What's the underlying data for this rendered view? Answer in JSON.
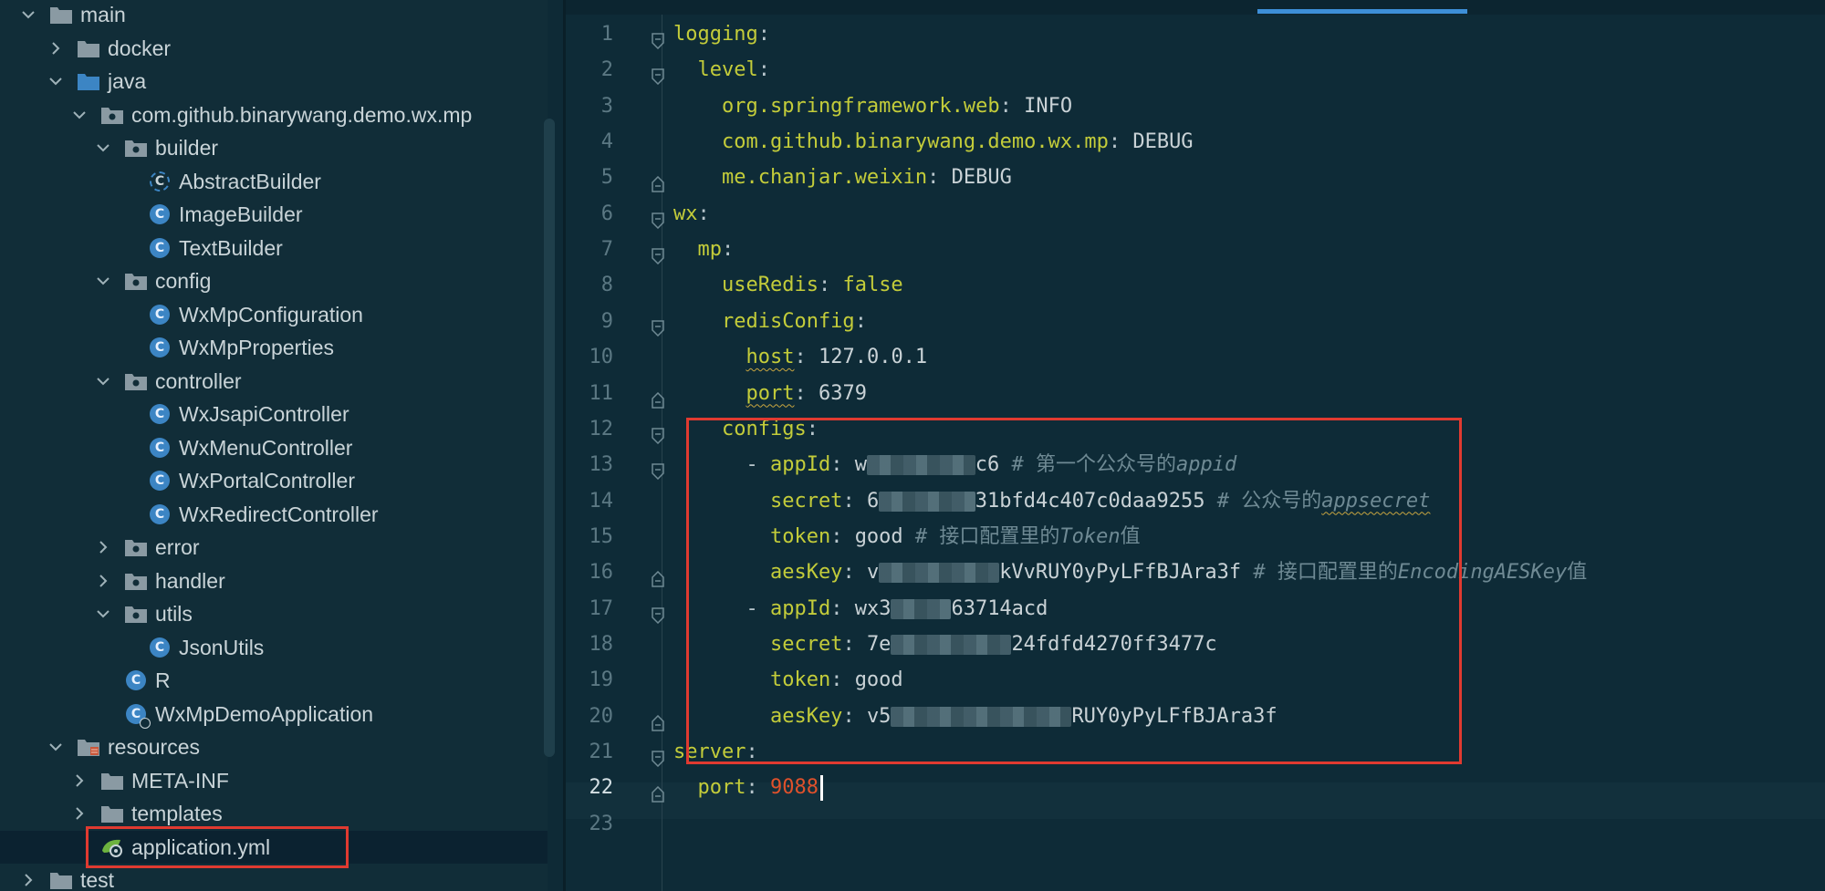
{
  "tree": {
    "items": [
      {
        "label": "main",
        "type": "folder",
        "expanded": true,
        "indent": 0,
        "icon": "folder-icon"
      },
      {
        "label": "docker",
        "type": "folder",
        "expanded": false,
        "indent": 1,
        "icon": "folder-icon"
      },
      {
        "label": "java",
        "type": "folder",
        "expanded": true,
        "indent": 1,
        "icon": "source-folder-icon"
      },
      {
        "label": "com.github.binarywang.demo.wx.mp",
        "type": "package",
        "expanded": true,
        "indent": 2,
        "icon": "package-icon"
      },
      {
        "label": "builder",
        "type": "package",
        "expanded": true,
        "indent": 3,
        "icon": "package-icon"
      },
      {
        "label": "AbstractBuilder",
        "type": "abstract-class",
        "indent": 4,
        "icon": "abstract-class-icon"
      },
      {
        "label": "ImageBuilder",
        "type": "class",
        "indent": 4,
        "icon": "class-icon"
      },
      {
        "label": "TextBuilder",
        "type": "class",
        "indent": 4,
        "icon": "class-icon"
      },
      {
        "label": "config",
        "type": "package",
        "expanded": true,
        "indent": 3,
        "icon": "package-icon"
      },
      {
        "label": "WxMpConfiguration",
        "type": "class",
        "indent": 4,
        "icon": "class-icon"
      },
      {
        "label": "WxMpProperties",
        "type": "class",
        "indent": 4,
        "icon": "class-icon"
      },
      {
        "label": "controller",
        "type": "package",
        "expanded": true,
        "indent": 3,
        "icon": "package-icon"
      },
      {
        "label": "WxJsapiController",
        "type": "class",
        "indent": 4,
        "icon": "class-icon"
      },
      {
        "label": "WxMenuController",
        "type": "class",
        "indent": 4,
        "icon": "class-icon"
      },
      {
        "label": "WxPortalController",
        "type": "class",
        "indent": 4,
        "icon": "class-icon"
      },
      {
        "label": "WxRedirectController",
        "type": "class",
        "indent": 4,
        "icon": "class-icon"
      },
      {
        "label": "error",
        "type": "package",
        "expanded": false,
        "indent": 3,
        "icon": "package-icon"
      },
      {
        "label": "handler",
        "type": "package",
        "expanded": false,
        "indent": 3,
        "icon": "package-icon"
      },
      {
        "label": "utils",
        "type": "package",
        "expanded": true,
        "indent": 3,
        "icon": "package-icon"
      },
      {
        "label": "JsonUtils",
        "type": "class",
        "indent": 4,
        "icon": "class-icon"
      },
      {
        "label": "R",
        "type": "class",
        "indent": 3,
        "icon": "class-icon"
      },
      {
        "label": "WxMpDemoApplication",
        "type": "spring-boot-class",
        "indent": 3,
        "icon": "spring-boot-class-icon"
      },
      {
        "label": "resources",
        "type": "folder",
        "expanded": true,
        "indent": 1,
        "icon": "resources-folder-icon"
      },
      {
        "label": "META-INF",
        "type": "folder",
        "expanded": false,
        "indent": 2,
        "icon": "folder-icon"
      },
      {
        "label": "templates",
        "type": "folder",
        "expanded": false,
        "indent": 2,
        "icon": "folder-icon"
      },
      {
        "label": "application.yml",
        "type": "yml",
        "indent": 2,
        "icon": "spring-yml-icon",
        "selected": true
      },
      {
        "label": "test",
        "type": "folder",
        "expanded": false,
        "indent": 0,
        "icon": "folder-icon"
      }
    ]
  },
  "editor": {
    "current_line": 22,
    "lines": [
      {
        "n": "1",
        "tokens": [
          {
            "t": "logging",
            "c": "k"
          },
          {
            "t": ":",
            "c": "p"
          }
        ]
      },
      {
        "n": "2",
        "tokens": [
          {
            "t": "  level",
            "c": "k"
          },
          {
            "t": ":",
            "c": "p"
          }
        ]
      },
      {
        "n": "3",
        "tokens": [
          {
            "t": "    org.springframework.web",
            "c": "k"
          },
          {
            "t": ": ",
            "c": "p"
          },
          {
            "t": "INFO",
            "c": "v"
          }
        ]
      },
      {
        "n": "4",
        "tokens": [
          {
            "t": "    com.github.binarywang.demo.wx.mp",
            "c": "k"
          },
          {
            "t": ": ",
            "c": "p"
          },
          {
            "t": "DEBUG",
            "c": "v"
          }
        ]
      },
      {
        "n": "5",
        "tokens": [
          {
            "t": "    me.chanjar.weixin",
            "c": "k"
          },
          {
            "t": ": ",
            "c": "p"
          },
          {
            "t": "DEBUG",
            "c": "v"
          }
        ]
      },
      {
        "n": "6",
        "tokens": [
          {
            "t": "wx",
            "c": "k"
          },
          {
            "t": ":",
            "c": "p"
          }
        ]
      },
      {
        "n": "7",
        "tokens": [
          {
            "t": "  mp",
            "c": "k"
          },
          {
            "t": ":",
            "c": "p"
          }
        ]
      },
      {
        "n": "8",
        "tokens": [
          {
            "t": "    useRedis",
            "c": "k"
          },
          {
            "t": ": ",
            "c": "p"
          },
          {
            "t": "false",
            "c": "k"
          }
        ]
      },
      {
        "n": "9",
        "tokens": [
          {
            "t": "    redisConfig",
            "c": "k"
          },
          {
            "t": ":",
            "c": "p"
          }
        ]
      },
      {
        "n": "10",
        "tokens": [
          {
            "t": "      ",
            "c": "p"
          },
          {
            "t": "host",
            "c": "k squig"
          },
          {
            "t": ": ",
            "c": "p"
          },
          {
            "t": "127.0.0.1",
            "c": "v"
          }
        ]
      },
      {
        "n": "11",
        "tokens": [
          {
            "t": "      ",
            "c": "p"
          },
          {
            "t": "port",
            "c": "k squig"
          },
          {
            "t": ": ",
            "c": "p"
          },
          {
            "t": "6379",
            "c": "v"
          }
        ]
      },
      {
        "n": "12",
        "tokens": [
          {
            "t": "    configs",
            "c": "k"
          },
          {
            "t": ":",
            "c": "p"
          }
        ]
      },
      {
        "n": "13",
        "tokens": [
          {
            "t": "      - ",
            "c": "p"
          },
          {
            "t": "appId",
            "c": "k"
          },
          {
            "t": ": ",
            "c": "p"
          },
          {
            "t": "w",
            "c": "v"
          },
          {
            "blur": 9
          },
          {
            "t": "c6",
            "c": "v"
          },
          {
            "t": " # 第一个公众号的",
            "c": "cz"
          },
          {
            "t": "appid",
            "c": "c"
          }
        ]
      },
      {
        "n": "14",
        "tokens": [
          {
            "t": "        secret",
            "c": "k"
          },
          {
            "t": ": ",
            "c": "p"
          },
          {
            "t": "6",
            "c": "v"
          },
          {
            "blur": 8
          },
          {
            "t": "31bfd4c407c0daa9255",
            "c": "v"
          },
          {
            "t": " # 公众号的",
            "c": "cz"
          },
          {
            "t": "appsecret",
            "c": "c squig"
          }
        ]
      },
      {
        "n": "15",
        "tokens": [
          {
            "t": "        token",
            "c": "k"
          },
          {
            "t": ": ",
            "c": "p"
          },
          {
            "t": "good",
            "c": "v"
          },
          {
            "t": " # 接口配置里的",
            "c": "cz"
          },
          {
            "t": "Token",
            "c": "c"
          },
          {
            "t": "值",
            "c": "cz"
          }
        ]
      },
      {
        "n": "16",
        "tokens": [
          {
            "t": "        aesKey",
            "c": "k"
          },
          {
            "t": ": ",
            "c": "p"
          },
          {
            "t": "v",
            "c": "v"
          },
          {
            "blur": 10
          },
          {
            "t": "kVvRUY0yPyLFfBJAra3f",
            "c": "v"
          },
          {
            "t": " # 接口配置里的",
            "c": "cz"
          },
          {
            "t": "EncodingAESKey",
            "c": "c"
          },
          {
            "t": "值",
            "c": "cz"
          }
        ]
      },
      {
        "n": "17",
        "tokens": [
          {
            "t": "      - ",
            "c": "p"
          },
          {
            "t": "appId",
            "c": "k"
          },
          {
            "t": ": ",
            "c": "p"
          },
          {
            "t": "wx3",
            "c": "v"
          },
          {
            "blur": 5
          },
          {
            "t": "63714acd",
            "c": "v"
          }
        ]
      },
      {
        "n": "18",
        "tokens": [
          {
            "t": "        secret",
            "c": "k"
          },
          {
            "t": ": ",
            "c": "p"
          },
          {
            "t": "7e",
            "c": "v"
          },
          {
            "blur": 10
          },
          {
            "t": "24fdfd4270ff3477c",
            "c": "v"
          }
        ]
      },
      {
        "n": "19",
        "tokens": [
          {
            "t": "        token",
            "c": "k"
          },
          {
            "t": ": ",
            "c": "p"
          },
          {
            "t": "good",
            "c": "v"
          }
        ]
      },
      {
        "n": "20",
        "tokens": [
          {
            "t": "        aesKey",
            "c": "k"
          },
          {
            "t": ": ",
            "c": "p"
          },
          {
            "t": "v5",
            "c": "v"
          },
          {
            "blur": 15
          },
          {
            "t": "RUY0yPyLFfBJAra3f",
            "c": "v"
          }
        ]
      },
      {
        "n": "21",
        "tokens": [
          {
            "t": "server",
            "c": "k"
          },
          {
            "t": ":",
            "c": "p"
          }
        ]
      },
      {
        "n": "22",
        "tokens": [
          {
            "t": "  port",
            "c": "k"
          },
          {
            "t": ": ",
            "c": "p"
          },
          {
            "t": "9088",
            "c": "num"
          },
          {
            "caret": true
          }
        ]
      },
      {
        "n": "23",
        "tokens": []
      }
    ]
  },
  "colors": {
    "accent": "#3d8fd8",
    "highlight_box": "#e03a30",
    "yaml_key": "#c3cc3a",
    "number": "#e0512b"
  }
}
